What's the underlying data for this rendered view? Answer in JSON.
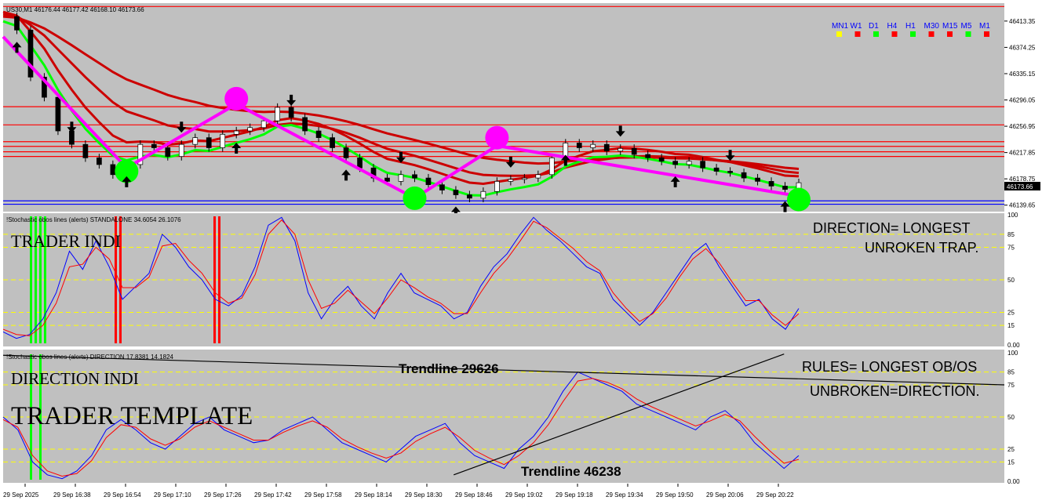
{
  "chart_data": [
    {
      "type": "line",
      "title": "US30,M1  46176.44 46177.42 46168.10 46173.66",
      "symbol": "US30,M1",
      "ohlc": {
        "open": 46176.44,
        "high": 46177.42,
        "low": 46168.1,
        "close": 46173.66
      },
      "ylim": [
        46130,
        46440
      ],
      "yticks": [
        "46413.35",
        "46374.25",
        "46335.15",
        "46296.05",
        "46256.95",
        "46217.85",
        "46178.75",
        "46139.65"
      ],
      "last_price_label": "46173.66",
      "timeframes": [
        {
          "label": "MN1",
          "color": "#ffff00"
        },
        {
          "label": "W1",
          "color": "#ff0000"
        },
        {
          "label": "D1",
          "color": "#00ff00"
        },
        {
          "label": "H4",
          "color": "#ff0000"
        },
        {
          "label": "H1",
          "color": "#00ff00"
        },
        {
          "label": "M30",
          "color": "#ff0000"
        },
        {
          "label": "M15",
          "color": "#ff0000"
        },
        {
          "label": "M5",
          "color": "#00ff00"
        },
        {
          "label": "M1",
          "color": "#ff0000"
        }
      ],
      "horizontal_levels": [
        {
          "price": 46435,
          "color": "#ff0000"
        },
        {
          "price": 46286,
          "color": "#ff0000"
        },
        {
          "price": 46259,
          "color": "#ff0000"
        },
        {
          "price": 46234,
          "color": "#ff0000"
        },
        {
          "price": 46227,
          "color": "#ff0000"
        },
        {
          "price": 46219,
          "color": "#ff0000"
        },
        {
          "price": 46212,
          "color": "#ff0000"
        },
        {
          "price": 46146,
          "color": "#0000ff"
        },
        {
          "price": 46141,
          "color": "#0000ff"
        }
      ],
      "price_series": [
        46420,
        46400,
        46330,
        46300,
        46250,
        46230,
        46210,
        46200,
        46185,
        46200,
        46230,
        46225,
        46212,
        46230,
        46240,
        46225,
        46245,
        46250,
        46255,
        46265,
        46285,
        46270,
        46250,
        46240,
        46225,
        46210,
        46195,
        46180,
        46175,
        46185,
        46180,
        46170,
        46162,
        46155,
        46150,
        46160,
        46175,
        46178,
        46180,
        46185,
        46210,
        46232,
        46225,
        46230,
        46220,
        46224,
        46215,
        46210,
        46205,
        46200,
        46205,
        46195,
        46190,
        46188,
        46180,
        46175,
        46168,
        46163,
        46173
      ],
      "zigzag_series": [
        {
          "name": "",
          "color": "#ff00ff",
          "points": [
            [
              0,
              46390
            ],
            [
              9,
              46195
            ],
            [
              17,
              46290
            ],
            [
              30,
              46150
            ],
            [
              36,
              46228
            ],
            [
              58,
              46153
            ]
          ]
        }
      ],
      "swing_markers": [
        {
          "idx": 9,
          "price": 46190,
          "color": "#00ff00"
        },
        {
          "idx": 17,
          "price": 46298,
          "color": "#ff00ff"
        },
        {
          "idx": 30,
          "price": 46150,
          "color": "#00ff00"
        },
        {
          "idx": 36,
          "price": 46240,
          "color": "#ff00ff"
        },
        {
          "idx": 58,
          "price": 46148,
          "color": "#00ff00"
        }
      ],
      "sessions": [
        {
          "start": 0.0,
          "end": 0.07,
          "shade": "#c0c0c0"
        },
        {
          "start": 0.2,
          "end": 0.27,
          "shade": "#c0c0c0"
        },
        {
          "start": 0.3,
          "end": 0.55,
          "shade": "#c0c0c0"
        },
        {
          "start": 0.62,
          "end": 0.68,
          "shade": "#c0c0c0"
        },
        {
          "start": 0.76,
          "end": 0.95,
          "shade": "#c0c0c0"
        }
      ]
    },
    {
      "type": "line",
      "title": "!Stochastic obos lines (alerts) STANDALONE 34.6054 26.1076",
      "ylim": [
        0,
        100
      ],
      "yticks": [
        "100",
        "85",
        "75",
        "50",
        "25",
        "15",
        "0.00"
      ],
      "levels": [
        85,
        75,
        50,
        25,
        15
      ],
      "main": [
        10,
        5,
        8,
        20,
        40,
        72,
        58,
        80,
        60,
        35,
        45,
        55,
        85,
        75,
        60,
        50,
        35,
        30,
        38,
        60,
        92,
        98,
        80,
        40,
        20,
        35,
        45,
        30,
        20,
        40,
        55,
        40,
        35,
        30,
        20,
        25,
        45,
        60,
        70,
        85,
        98,
        88,
        80,
        70,
        60,
        55,
        35,
        25,
        15,
        25,
        40,
        55,
        70,
        78,
        60,
        45,
        30,
        35,
        20,
        12,
        28
      ],
      "signal": [
        12,
        8,
        7,
        15,
        32,
        60,
        62,
        75,
        66,
        44,
        44,
        52,
        76,
        78,
        65,
        55,
        40,
        32,
        36,
        54,
        85,
        96,
        85,
        50,
        28,
        32,
        42,
        33,
        24,
        36,
        50,
        44,
        37,
        32,
        24,
        24,
        40,
        55,
        66,
        80,
        95,
        90,
        82,
        74,
        64,
        57,
        40,
        28,
        18,
        24,
        36,
        52,
        66,
        74,
        63,
        48,
        34,
        34,
        23,
        15,
        24
      ],
      "bars": [
        {
          "idx": 1,
          "color": "#00ff00"
        },
        {
          "idx": 2,
          "color": "#00ff00"
        },
        {
          "idx": 3,
          "color": "#00ff00"
        },
        {
          "idx": 4,
          "color": "#00ff00"
        },
        {
          "idx": 19,
          "color": "#ff0000"
        },
        {
          "idx": 20,
          "color": "#ff0000"
        },
        {
          "idx": 40,
          "color": "#ff0000"
        },
        {
          "idx": 41,
          "color": "#ff0000"
        }
      ]
    },
    {
      "type": "line",
      "title": "!Stochastic obos lines (alerts) DIRECTION 17.8381 14.1824",
      "ylim": [
        0,
        100
      ],
      "yticks": [
        "100",
        "85",
        "75",
        "50",
        "25",
        "15",
        "0.00"
      ],
      "levels": [
        85,
        75,
        50,
        25,
        15
      ],
      "main": [
        50,
        40,
        15,
        5,
        2,
        8,
        20,
        40,
        48,
        40,
        30,
        25,
        35,
        45,
        50,
        40,
        35,
        30,
        32,
        40,
        45,
        50,
        40,
        30,
        25,
        20,
        15,
        25,
        35,
        40,
        45,
        30,
        20,
        15,
        10,
        25,
        35,
        50,
        70,
        85,
        80,
        75,
        70,
        60,
        55,
        50,
        45,
        40,
        50,
        55,
        45,
        30,
        20,
        10,
        20
      ],
      "signal": [
        48,
        42,
        20,
        8,
        4,
        6,
        16,
        34,
        44,
        42,
        33,
        28,
        33,
        42,
        47,
        42,
        37,
        32,
        32,
        38,
        43,
        47,
        42,
        33,
        27,
        22,
        18,
        22,
        31,
        37,
        42,
        34,
        24,
        18,
        13,
        20,
        30,
        44,
        62,
        78,
        80,
        77,
        72,
        64,
        58,
        53,
        48,
        43,
        47,
        52,
        47,
        35,
        24,
        14,
        17
      ],
      "trendlines": [
        {
          "label": "Trendline 29626",
          "from": [
            0,
            98
          ],
          "to": [
            1,
            75
          ]
        },
        {
          "label": "Trendline 46238",
          "from": [
            0.45,
            5
          ],
          "to": [
            0.78,
            99
          ]
        }
      ],
      "bars": [
        {
          "idx": 1,
          "color": "#00ff00"
        },
        {
          "idx": 3,
          "color": "#00ff00"
        }
      ]
    }
  ],
  "x_axis": {
    "ticks": [
      "29 Sep 2025",
      "29 Sep 16:38",
      "29 Sep 16:54",
      "29 Sep 17:10",
      "29 Sep 17:26",
      "29 Sep 17:42",
      "29 Sep 17:58",
      "29 Sep 18:14",
      "29 Sep 18:30",
      "29 Sep 18:46",
      "29 Sep 19:02",
      "29 Sep 19:18",
      "29 Sep 19:34",
      "29 Sep 19:50",
      "29 Sep 20:06",
      "29 Sep 20:22"
    ]
  },
  "annotations": {
    "trader_indi": "TRADER INDI",
    "direction_indi": "DIRECTION INDI",
    "trader_template": "TRADER TEMPLATE",
    "rule1_line1": "DIRECTION= LONGEST",
    "rule1_line2": "UNROKEN TRAP.",
    "rule2_line1": "RULES= LONGEST OB/OS",
    "rule2_line2": "UNBROKEN=DIRECTION.",
    "trendline1": "Trendline 29626",
    "trendline2": "Trendline 46238"
  },
  "colors": {
    "pane_bg": "#c0c0c0",
    "stoch_main": "#0000ff",
    "stoch_signal": "#ff0000",
    "ema_red": "#cc0000",
    "ema_green": "#00ff00",
    "zigzag": "#ff00ff",
    "levels": "#ffff00"
  }
}
